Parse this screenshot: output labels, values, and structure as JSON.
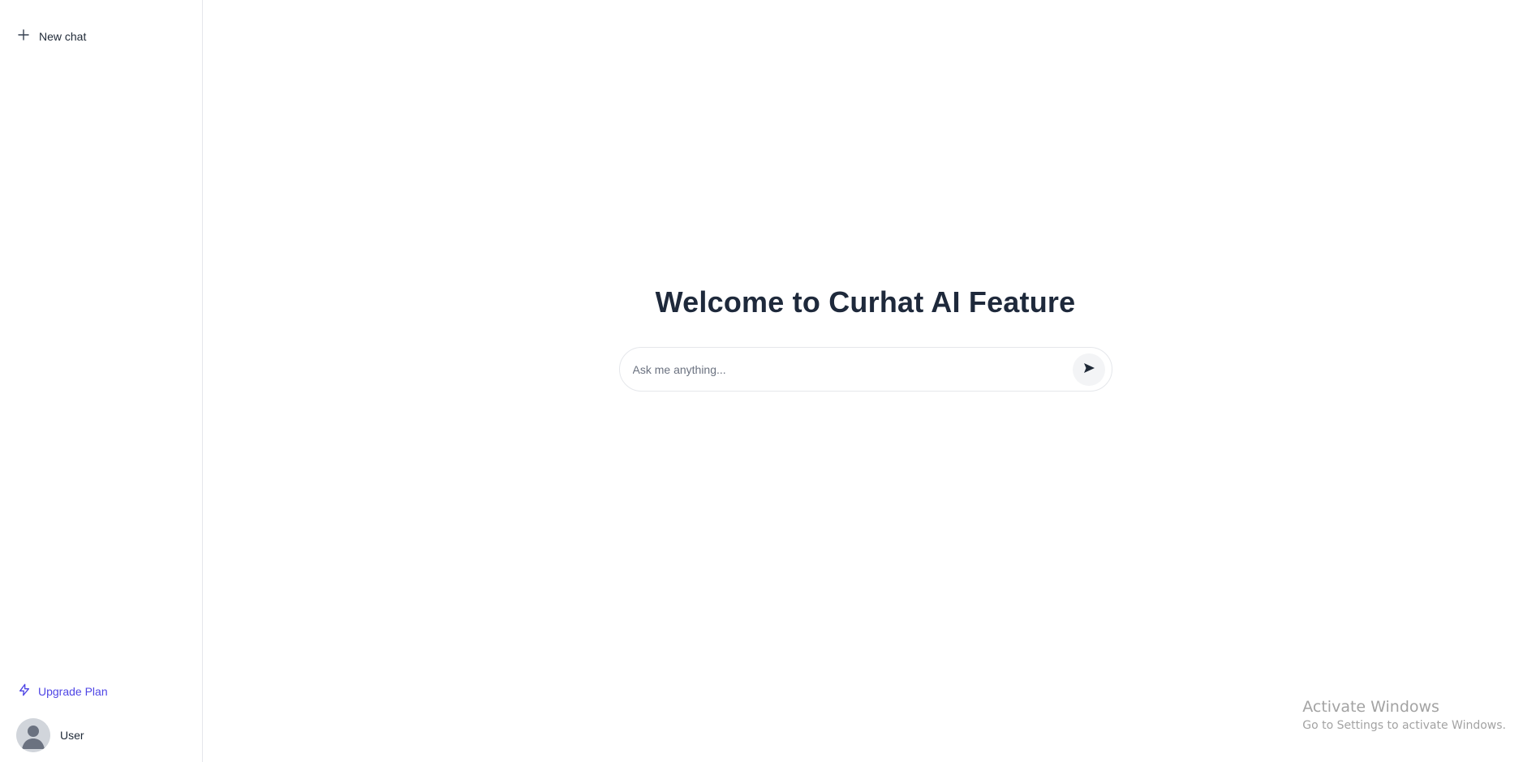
{
  "sidebar": {
    "new_chat_label": "New chat",
    "upgrade_label": "Upgrade Plan",
    "user_name": "User"
  },
  "main": {
    "title": "Welcome to Curhat AI Feature",
    "search_placeholder": "Ask me anything..."
  },
  "watermark": {
    "title": "Activate Windows",
    "subtitle": "Go to Settings to activate Windows."
  },
  "icons": {
    "new_chat": "plus-icon",
    "upgrade": "lightning-icon",
    "avatar": "user-avatar-icon",
    "send": "send-arrow-icon"
  },
  "colors": {
    "accent": "#4f46e5",
    "title": "#1e293b",
    "border": "#e5e7eb"
  }
}
